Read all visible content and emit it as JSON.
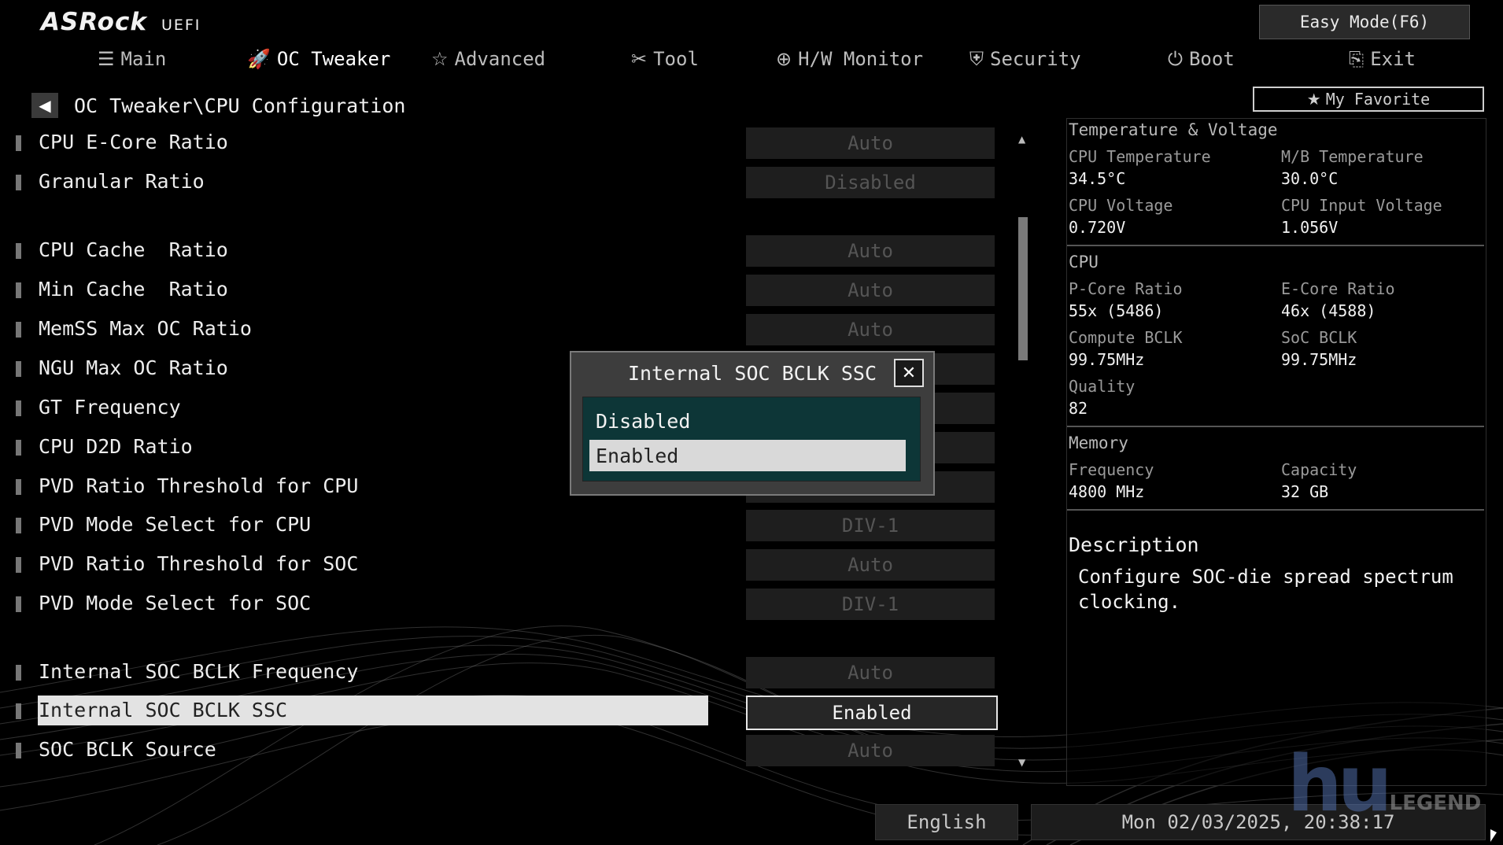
{
  "header": {
    "brand": "ASRock",
    "brand_sub": "UEFI",
    "easy_mode_label": "Easy Mode(F6)",
    "favorite_label": "My Favorite"
  },
  "tabs": [
    {
      "label": "Main",
      "icon": "list-icon",
      "glyph": "☰"
    },
    {
      "label": "OC Tweaker",
      "icon": "rocket-icon",
      "glyph": "🚀",
      "active": true
    },
    {
      "label": "Advanced",
      "icon": "star-icon",
      "glyph": "☆"
    },
    {
      "label": "Tool",
      "icon": "tools-icon",
      "glyph": "✂"
    },
    {
      "label": "H/W Monitor",
      "icon": "crosshair-icon",
      "glyph": "⊕"
    },
    {
      "label": "Security",
      "icon": "shield-icon",
      "glyph": "⛨"
    },
    {
      "label": "Boot",
      "icon": "power-icon",
      "glyph": "⏻"
    },
    {
      "label": "Exit",
      "icon": "exit-icon",
      "glyph": "⎘"
    }
  ],
  "breadcrumb": "OC Tweaker\\CPU Configuration",
  "settings": [
    {
      "label": "CPU E-Core Ratio",
      "value": "Auto"
    },
    {
      "label": "Granular Ratio",
      "value": "Disabled"
    },
    {
      "label": "CPU Cache  Ratio",
      "value": "Auto"
    },
    {
      "label": "Min Cache  Ratio",
      "value": "Auto"
    },
    {
      "label": "MemSS Max OC Ratio",
      "value": "Auto"
    },
    {
      "label": "NGU Max OC Ratio",
      "value": ""
    },
    {
      "label": "GT Frequency",
      "value": ""
    },
    {
      "label": "CPU D2D Ratio",
      "value": ""
    },
    {
      "label": "PVD Ratio Threshold for CPU",
      "value": ""
    },
    {
      "label": "PVD Mode Select for CPU",
      "value": "DIV-1"
    },
    {
      "label": "PVD Ratio Threshold for SOC",
      "value": "Auto"
    },
    {
      "label": "PVD Mode Select for SOC",
      "value": "DIV-1"
    },
    {
      "label": "Internal SOC BCLK Frequency",
      "value": "Auto"
    },
    {
      "label": "Internal SOC BCLK SSC",
      "value": "Enabled",
      "selected": true
    },
    {
      "label": "SOC BCLK Source",
      "value": "Auto"
    }
  ],
  "popup": {
    "title": "Internal SOC BCLK SSC",
    "options": [
      "Disabled",
      "Enabled"
    ],
    "selected_index": 1
  },
  "info": {
    "temp_title": "Temperature & Voltage",
    "cpu_temp_label": "CPU Temperature",
    "cpu_temp": "34.5°C",
    "mb_temp_label": "M/B Temperature",
    "mb_temp": "30.0°C",
    "cpu_volt_label": "CPU Voltage",
    "cpu_volt": "0.720V",
    "cpu_in_volt_label": "CPU Input Voltage",
    "cpu_in_volt": "1.056V",
    "cpu_title": "CPU",
    "pcore_label": "P-Core Ratio",
    "pcore": "55x (5486)",
    "ecore_label": "E-Core Ratio",
    "ecore": "46x (4588)",
    "compute_bclk_label": "Compute BCLK",
    "compute_bclk": "99.75MHz",
    "soc_bclk_label": "SoC BCLK",
    "soc_bclk": "99.75MHz",
    "quality_label": "Quality",
    "quality": "82",
    "mem_title": "Memory",
    "freq_label": "Frequency",
    "freq": "4800 MHz",
    "cap_label": "Capacity",
    "cap": "32 GB",
    "desc_title": "Description",
    "desc_text": "Configure SOC-die spread spectrum clocking."
  },
  "status": {
    "language": "English",
    "datetime": "Mon 02/03/2025, 20:38:17"
  },
  "watermark": "LEGEND"
}
